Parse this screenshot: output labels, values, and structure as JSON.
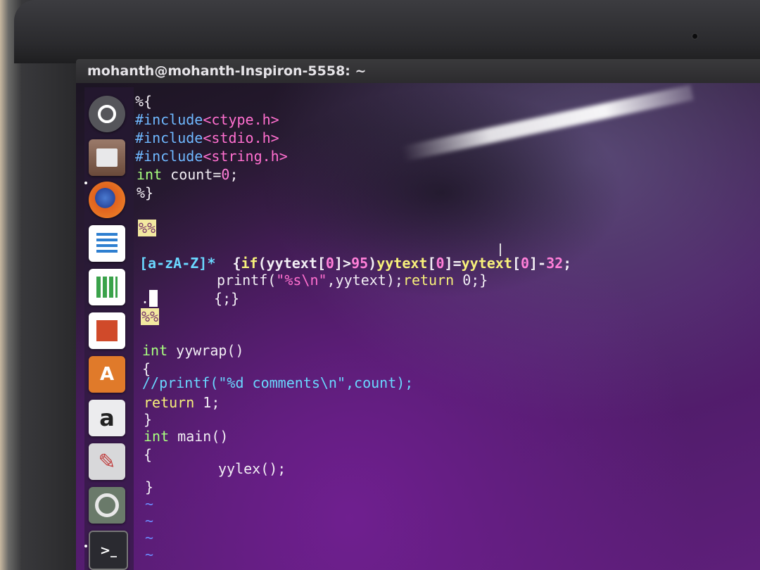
{
  "window": {
    "title": "mohanth@mohanth-Inspiron-5558: ~"
  },
  "launcher": {
    "items": [
      {
        "name": "ubuntu-dash-icon",
        "glyph": "◎",
        "color": "#5a5a5e"
      },
      {
        "name": "files-icon",
        "glyph": "▤",
        "color": "#8a6a5a"
      },
      {
        "name": "firefox-icon",
        "glyph": "◉",
        "color": "#e0621e"
      },
      {
        "name": "writer-icon",
        "glyph": "▤",
        "color": "#2e7fd0"
      },
      {
        "name": "calc-icon",
        "glyph": "▦",
        "color": "#3aa24a"
      },
      {
        "name": "impress-icon",
        "glyph": "▤",
        "color": "#d04a2a"
      },
      {
        "name": "software-center-icon",
        "glyph": "A",
        "color": "#e07a2a"
      },
      {
        "name": "amazon-icon",
        "glyph": "a",
        "color": "#e9e9ea"
      },
      {
        "name": "settings-icon",
        "glyph": "✎",
        "color": "#c84a4a"
      },
      {
        "name": "software-updater-icon",
        "glyph": "◍",
        "color": "#4a8a3a"
      },
      {
        "name": "terminal-icon",
        "glyph": "▭",
        "color": "#3a3a40"
      }
    ]
  },
  "code": {
    "l1": "%{",
    "l2_kw": "#include",
    "l2_hdr": "<ctype.h>",
    "l3_kw": "#include",
    "l3_hdr": "<stdio.h>",
    "l4_kw": "#include",
    "l4_hdr": "<string.h>",
    "l5_type": "int",
    "l5_rest": " count=",
    "l5_num": "0",
    "l5_end": ";",
    "l6": "%}",
    "l7": "%%",
    "l8_pat": "[a-zA-Z]*",
    "l8_a": "  {",
    "l8_if": "if",
    "l8_b": "(yytext[",
    "l8_n0": "0",
    "l8_c": "]>",
    "l8_n95": "95",
    "l8_d": ")",
    "l8_yy1": "yytext",
    "l8_e": "[",
    "l8_n0b": "0",
    "l8_f": "]=",
    "l8_yy2": "yytext",
    "l8_g": "[",
    "l8_n0c": "0",
    "l8_h": "]-",
    "l8_n32": "32",
    "l8_i": ";",
    "l9_a": "printf(",
    "l9_str": "\"%s\\n\"",
    "l9_b": ",yytext);",
    "l9_ret": "return",
    "l9_c": " 0;}",
    "l10_dot": ".",
    "l10_body": "{;}",
    "l11": "%%",
    "l12_type": "int",
    "l12_rest": " yywrap()",
    "l13": "{",
    "l14": "//printf(\"%d comments\\n\",count);",
    "l15_kw": "return",
    "l15_rest": " 1;",
    "l16": "}",
    "l17_type": "int",
    "l17_rest": " main()",
    "l18": "{",
    "l19": "yylex();",
    "l20": "}",
    "tilde": "~"
  }
}
